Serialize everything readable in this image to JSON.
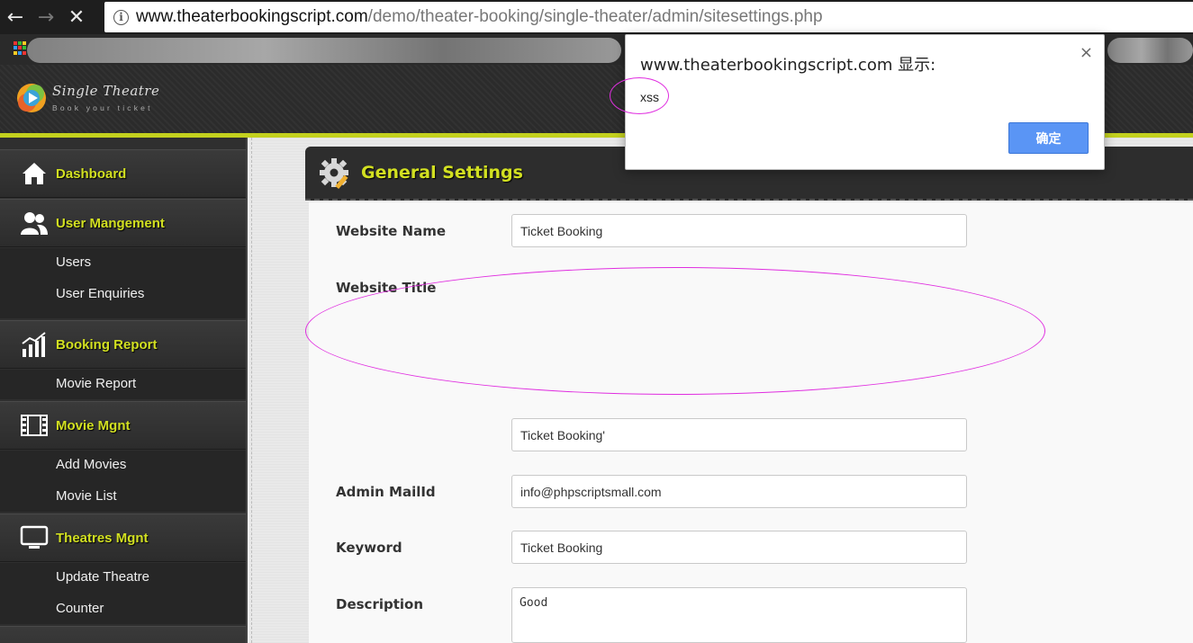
{
  "browser": {
    "url_host": "www.theaterbookingscript.com",
    "url_path": "/demo/theater-booking/single-theater/admin/sitesettings.php"
  },
  "site": {
    "logo_title": "Single Theatre",
    "logo_tagline": "Book your ticket"
  },
  "sidebar": {
    "dashboard": "Dashboard",
    "user_management": "User Mangement",
    "users": "Users",
    "user_enquiries": "User Enquiries",
    "booking_report": "Booking Report",
    "movie_report": "Movie Report",
    "movie_mgnt": "Movie Mgnt",
    "add_movies": "Add Movies",
    "movie_list": "Movie List",
    "theatres_mgnt": "Theatres Mgnt",
    "update_theatre": "Update Theatre",
    "counter": "Counter"
  },
  "panel": {
    "title": "General Settings"
  },
  "form": {
    "website_name_label": "Website Name",
    "website_name_value": "Ticket Booking",
    "website_title_label": "Website Title",
    "website_title_value": "Ticket Booking'",
    "admin_mail_label": "Admin MailId",
    "admin_mail_value": "info@phpscriptsmall.com",
    "keyword_label": "Keyword",
    "keyword_value": "Ticket Booking",
    "description_label": "Description",
    "description_value": "Good"
  },
  "dialog": {
    "title": "www.theaterbookingscript.com 显示:",
    "message": "xss",
    "ok_label": "确定",
    "close_symbol": "×"
  },
  "colors": {
    "accent": "#d2e021",
    "annotation": "#e02ee0",
    "ok_button": "#5a95f5"
  }
}
